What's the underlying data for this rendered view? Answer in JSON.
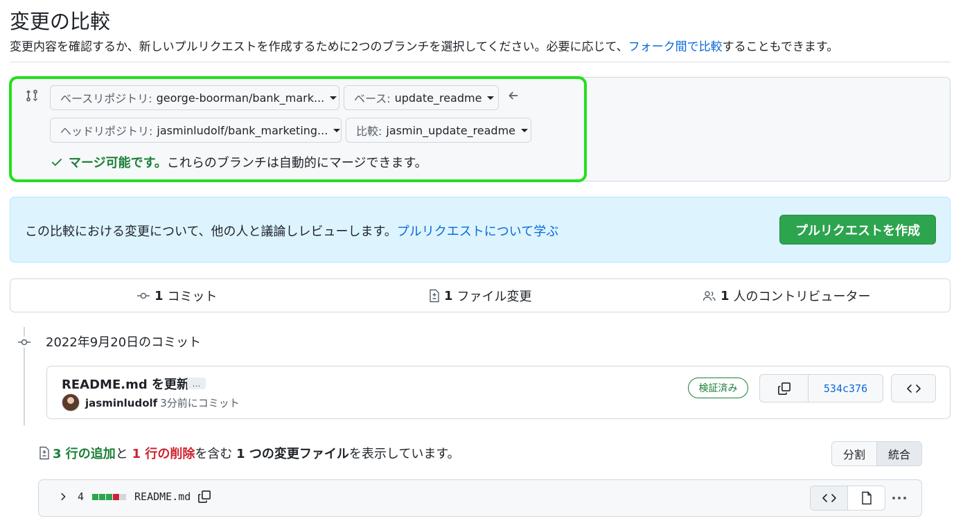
{
  "header": {
    "title": "変更の比較",
    "subtitle_before": "変更内容を確認するか、新しいプルリクエストを作成するために2つのブランチを選択してください。必要に応じて、",
    "subtitle_link": "フォーク間で比較",
    "subtitle_after": "することもできます。"
  },
  "range": {
    "base_repo_prefix": "ベースリポジトリ:",
    "base_repo_value": "george-boorman/bank_mark...",
    "base_prefix": "ベース:",
    "base_value": "update_readme",
    "head_repo_prefix": "ヘッドリポジトリ:",
    "head_repo_value": "jasminludolf/bank_marketing...",
    "compare_prefix": "比較:",
    "compare_value": "jasmin_update_readme",
    "merge_ok": "マージ可能です。",
    "merge_text": "これらのブランチは自動的にマージできます。"
  },
  "pr_banner": {
    "text": "この比較における変更について、他の人と議論しレビューします。",
    "link": "プルリクエストについて学ぶ",
    "button": "プルリクエストを作成"
  },
  "stats": {
    "commits_count": "1",
    "commits_label": "コミット",
    "files_count": "1",
    "files_label": "ファイル変更",
    "contributors_count": "1",
    "contributors_label": "人のコントリビューター"
  },
  "timeline": {
    "date": "2022年9月20日のコミット"
  },
  "commit": {
    "title": "README.md を更新",
    "ellipsis": "…",
    "author": "jasminludolf",
    "ago": "3分前にコミット",
    "verified": "検証済み",
    "sha": "534c376"
  },
  "diff_summary": {
    "add_text": "3 行の追加",
    "and": "と ",
    "del_text": "1 行の削除",
    "middle": "を含む ",
    "files_text": "1 つの変更ファイル",
    "end": "を表示しています。",
    "split": "分割",
    "unified": "統合"
  },
  "file": {
    "changes": "4",
    "name": "README.md",
    "bar_colors": [
      "#2da44e",
      "#2da44e",
      "#2da44e",
      "#cf222e",
      "#d0d7de"
    ]
  },
  "colors": {
    "accent": "#0969da",
    "success": "#1a7f37",
    "danger": "#cf222e",
    "highlight": "#21e01b",
    "pr_button": "#2da44e"
  }
}
